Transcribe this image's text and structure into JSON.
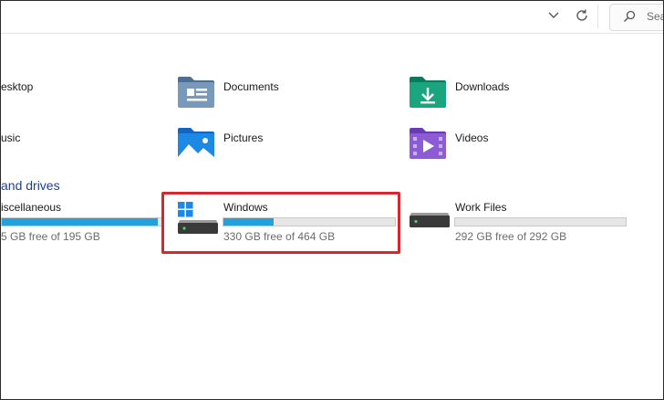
{
  "search": {
    "placeholder": "Sea"
  },
  "folders": [
    {
      "label": "esktop"
    },
    {
      "label": "Documents"
    },
    {
      "label": "Downloads"
    },
    {
      "label": "usic"
    },
    {
      "label": "Pictures"
    },
    {
      "label": "Videos"
    }
  ],
  "drives_section": {
    "title": "and drives"
  },
  "drives": [
    {
      "name": "iscellaneous",
      "free_text": "5 GB free of 195 GB",
      "used_fraction": 0.97
    },
    {
      "name": "Windows",
      "free_text": "330 GB free of 464 GB",
      "used_fraction": 0.29
    },
    {
      "name": "Work Files",
      "free_text": "292 GB free of 292 GB",
      "used_fraction": 0.0
    }
  ],
  "colors": {
    "accent_blue": "#26a0da",
    "highlight_red": "#d6272f",
    "section_blue": "#1f3f8c"
  }
}
